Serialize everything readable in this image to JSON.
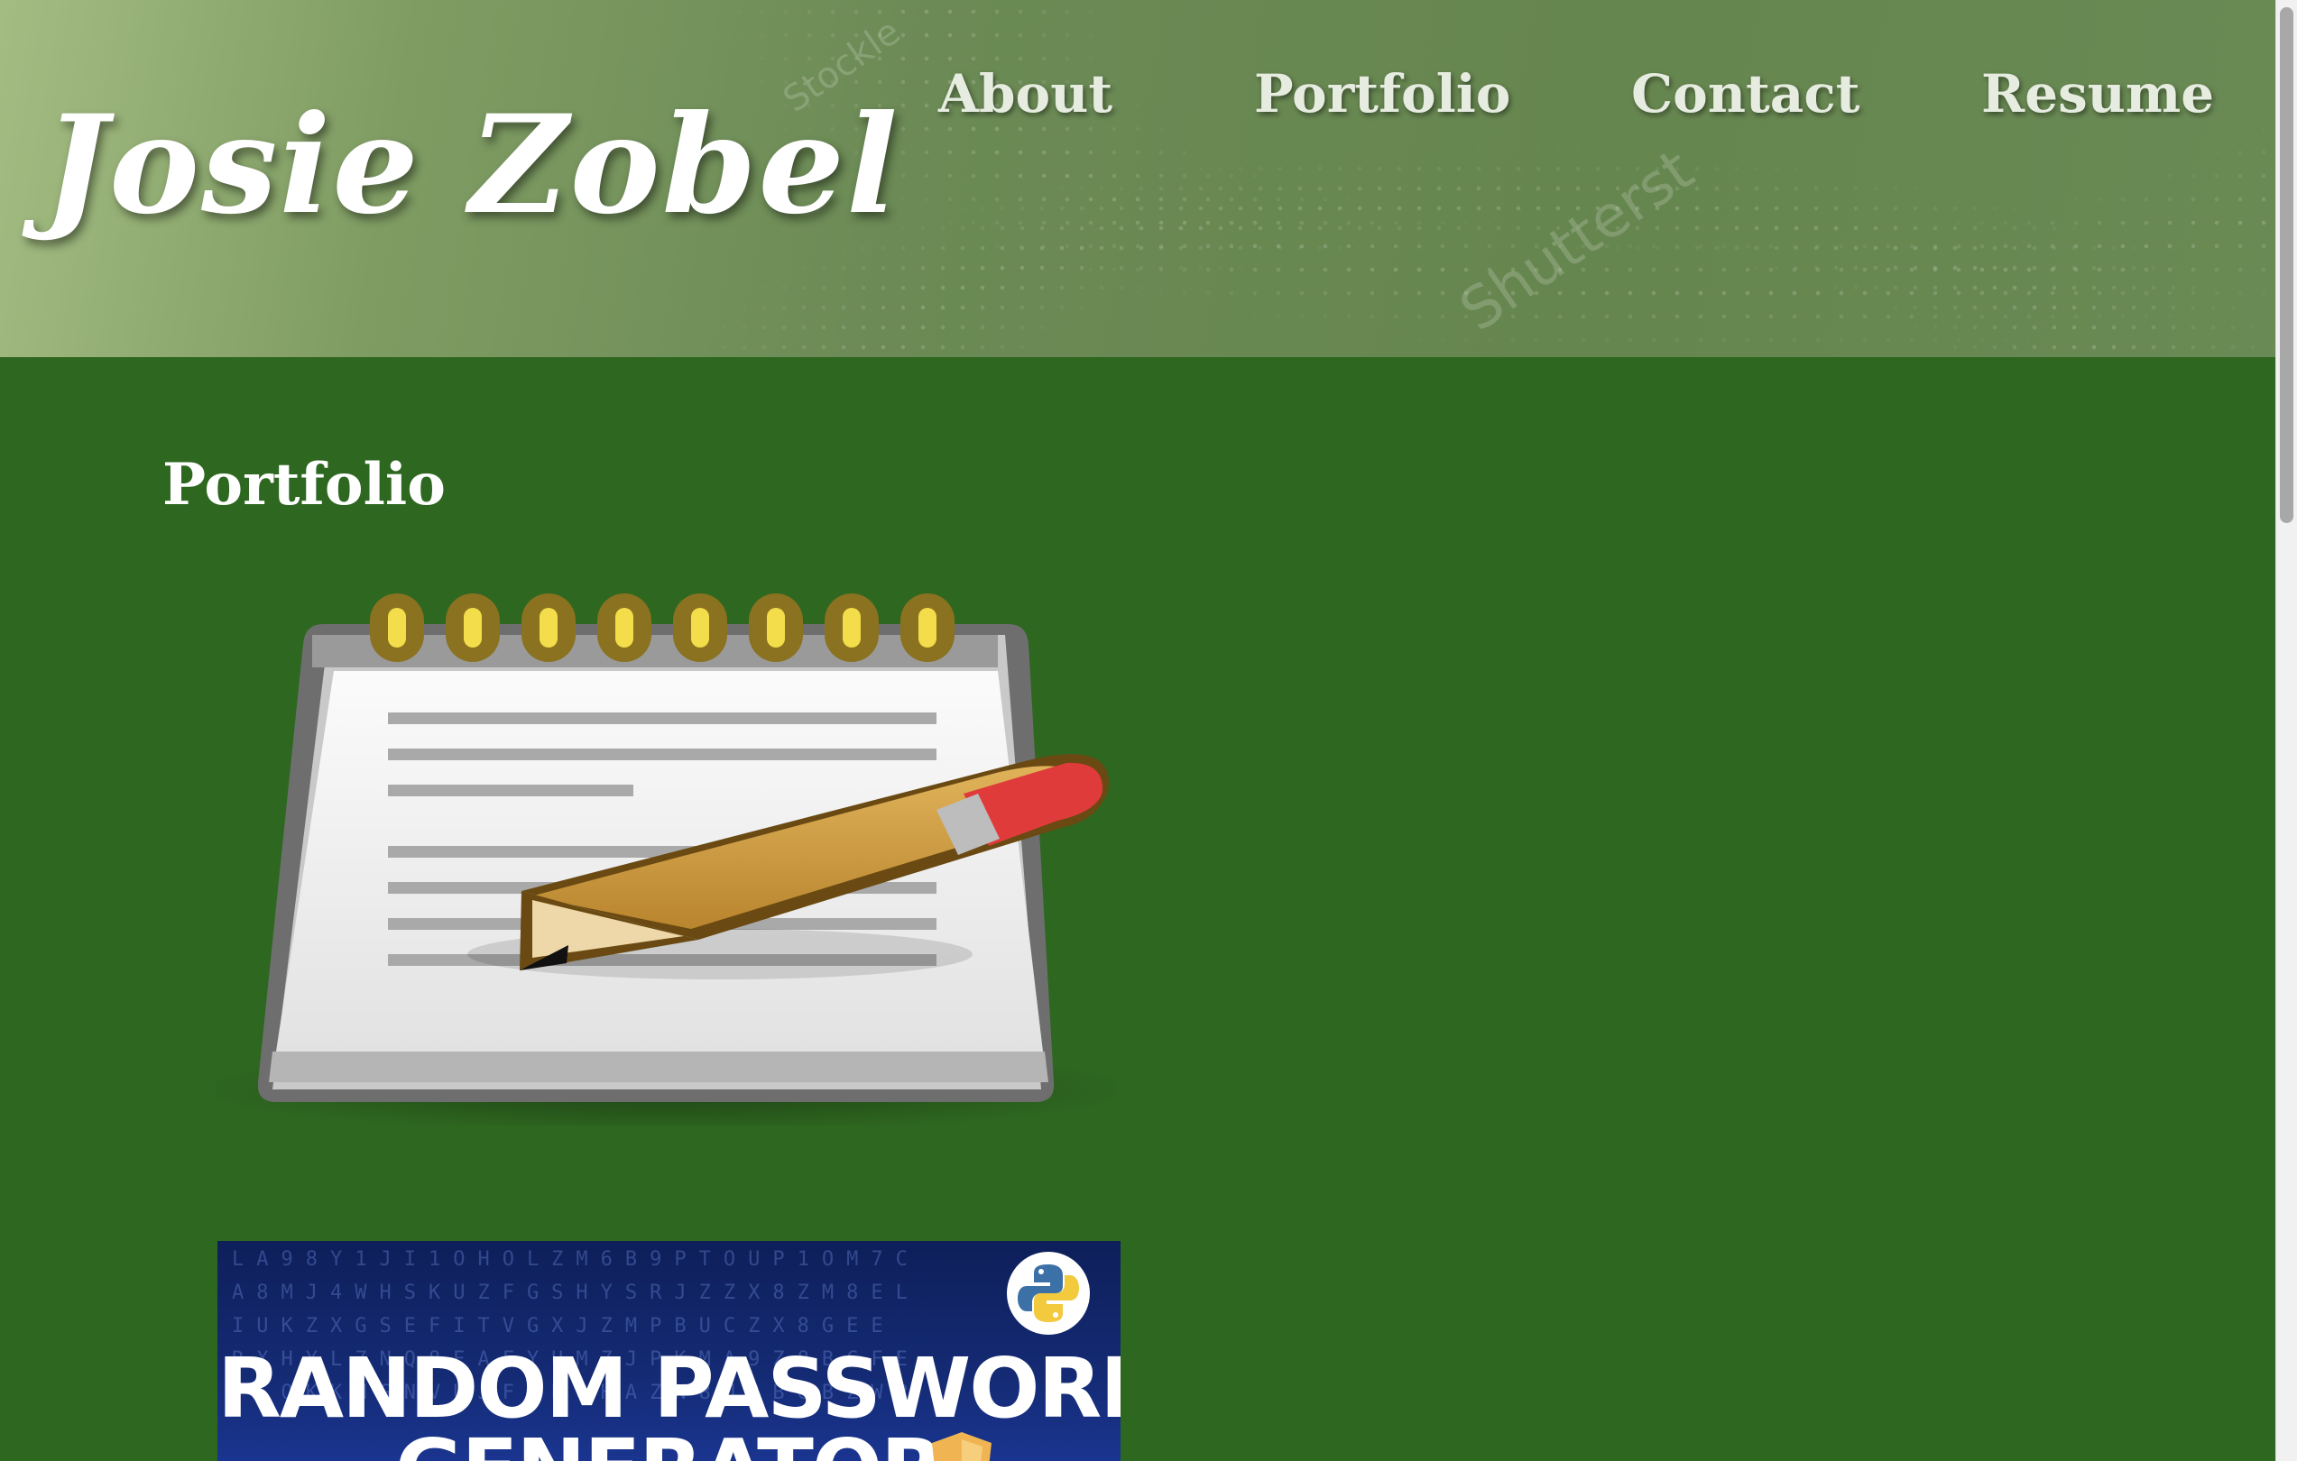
{
  "site": {
    "name": "Josie Zobel"
  },
  "nav": {
    "items": [
      {
        "label": "About"
      },
      {
        "label": "Portfolio"
      },
      {
        "label": "Contact"
      },
      {
        "label": "Resume"
      }
    ]
  },
  "header_watermark": {
    "text1": "Stockle",
    "text2": "Shutterst"
  },
  "portfolio": {
    "title": "Portfolio",
    "projects": [
      {
        "icon": "notepad-pencil-icon"
      },
      {
        "icon": "python-logo-icon",
        "title_line1": "RANDOM PASSWORD",
        "title_line2": "GENERATOR",
        "background_code": "LA98Y1JI1OHOLZM6B9PTOUP1OM7C\nA8MJ4WHSKUZFGSHYSRJZZX8ZM8EL\nIUKZXGSEFITVGXJZMPBUCZX8GEE\nRXHYLZNQ8EAFYUMZJPKMA9Z8BCFE\nTSOKKMGNVUJFPK8HAZN8U3BGBZWP"
      }
    ]
  },
  "colors": {
    "background": "#2e6720",
    "header": "#6b8a55",
    "text": "#ffffff"
  }
}
